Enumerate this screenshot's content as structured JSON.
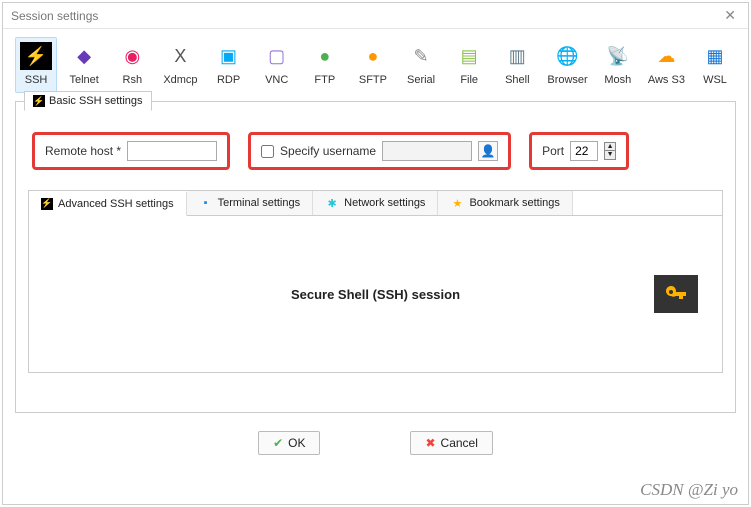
{
  "window": {
    "title": "Session settings"
  },
  "protocols": [
    {
      "id": "ssh",
      "label": "SSH",
      "color": "#000",
      "emoji": "⚡"
    },
    {
      "id": "telnet",
      "label": "Telnet",
      "color": "#673ab7",
      "emoji": "◆"
    },
    {
      "id": "rsh",
      "label": "Rsh",
      "color": "#e91e63",
      "emoji": "◉"
    },
    {
      "id": "xdmcp",
      "label": "Xdmcp",
      "color": "#555",
      "emoji": "X"
    },
    {
      "id": "rdp",
      "label": "RDP",
      "color": "#03a9f4",
      "emoji": "▣"
    },
    {
      "id": "vnc",
      "label": "VNC",
      "color": "#9575cd",
      "emoji": "▢"
    },
    {
      "id": "ftp",
      "label": "FTP",
      "color": "#4caf50",
      "emoji": "●"
    },
    {
      "id": "sftp",
      "label": "SFTP",
      "color": "#ff9800",
      "emoji": "●"
    },
    {
      "id": "serial",
      "label": "Serial",
      "color": "#888",
      "emoji": "✎"
    },
    {
      "id": "file",
      "label": "File",
      "color": "#8bc34a",
      "emoji": "▤"
    },
    {
      "id": "shell",
      "label": "Shell",
      "color": "#607d8b",
      "emoji": "▥"
    },
    {
      "id": "browser",
      "label": "Browser",
      "color": "#2196f3",
      "emoji": "🌐"
    },
    {
      "id": "mosh",
      "label": "Mosh",
      "color": "#03a9f4",
      "emoji": "📡"
    },
    {
      "id": "awss3",
      "label": "Aws S3",
      "color": "#ff9800",
      "emoji": "☁"
    },
    {
      "id": "wsl",
      "label": "WSL",
      "color": "#1976d2",
      "emoji": "▦"
    }
  ],
  "selected_protocol": "ssh",
  "basic_tab_label": "Basic SSH settings",
  "fields": {
    "remote_host_label": "Remote host *",
    "remote_host_value": "",
    "specify_user_label": "Specify username",
    "specify_user_checked": false,
    "username_value": "",
    "port_label": "Port",
    "port_value": "22"
  },
  "subtabs": [
    {
      "id": "advanced",
      "label": "Advanced SSH settings",
      "icon": "⚡",
      "color": "#000"
    },
    {
      "id": "terminal",
      "label": "Terminal settings",
      "icon": "▪",
      "color": "#1e88e5"
    },
    {
      "id": "network",
      "label": "Network settings",
      "icon": "✱",
      "color": "#26c6da"
    },
    {
      "id": "bookmark",
      "label": "Bookmark settings",
      "icon": "★",
      "color": "#ffb300"
    }
  ],
  "session_body_title": "Secure Shell (SSH) session",
  "buttons": {
    "ok": "OK",
    "cancel": "Cancel"
  },
  "watermark": "CSDN @Zi yo"
}
